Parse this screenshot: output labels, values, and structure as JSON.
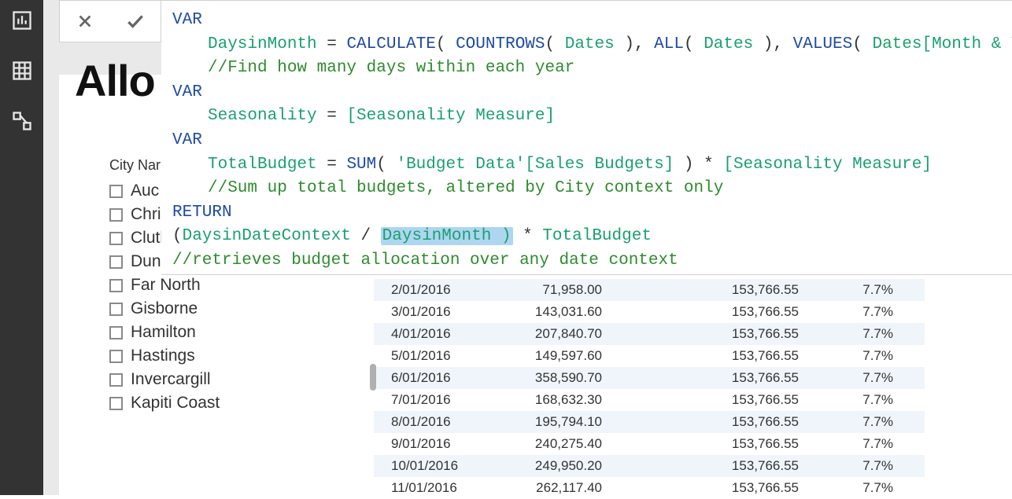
{
  "page_title": "Allo",
  "slicer": {
    "label": "City Nar",
    "items": [
      "Auc",
      "Christchurch",
      "Clutha",
      "Dunedin",
      "Far North",
      "Gisborne",
      "Hamilton",
      "Hastings",
      "Invercargill",
      "Kapiti Coast"
    ]
  },
  "formula": {
    "kw_var": "VAR",
    "kw_return": "RETURN",
    "kw_and": "&",
    "line1_name": "DaysinMonth",
    "line1_eq": " = ",
    "fn_calculate": "CALCULATE",
    "fn_countrows": "COUNTROWS",
    "fn_all": "ALL",
    "fn_values": "VALUES",
    "tbl_dates": "Dates",
    "col_monthyear": "Dates[Month & Year]",
    "cm1": "//Find how many days within each year",
    "line2_name": "Seasonality",
    "meas_seasonality": "[Seasonality Measure]",
    "line3_name": "TotalBudget",
    "fn_sum": "SUM",
    "ref_salesbudgets": "'Budget Data'[Sales Budgets]",
    "cm2": "//Sum up total budgets, altered by City context only",
    "ret_a": "DaysinDateContext",
    "ret_b": "DaysinMonth )",
    "ret_c": "TotalBudget",
    "cm3": "//retrieves budget allocation over any date context"
  },
  "table": {
    "rows": [
      {
        "date": "2/01/2016",
        "v1": "71,958.00",
        "v2": "153,766.55",
        "v3": "7.7%"
      },
      {
        "date": "3/01/2016",
        "v1": "143,031.60",
        "v2": "153,766.55",
        "v3": "7.7%"
      },
      {
        "date": "4/01/2016",
        "v1": "207,840.70",
        "v2": "153,766.55",
        "v3": "7.7%"
      },
      {
        "date": "5/01/2016",
        "v1": "149,597.60",
        "v2": "153,766.55",
        "v3": "7.7%"
      },
      {
        "date": "6/01/2016",
        "v1": "358,590.70",
        "v2": "153,766.55",
        "v3": "7.7%"
      },
      {
        "date": "7/01/2016",
        "v1": "168,632.30",
        "v2": "153,766.55",
        "v3": "7.7%"
      },
      {
        "date": "8/01/2016",
        "v1": "195,794.10",
        "v2": "153,766.55",
        "v3": "7.7%"
      },
      {
        "date": "9/01/2016",
        "v1": "240,275.40",
        "v2": "153,766.55",
        "v3": "7.7%"
      },
      {
        "date": "10/01/2016",
        "v1": "249,950.20",
        "v2": "153,766.55",
        "v3": "7.7%"
      },
      {
        "date": "11/01/2016",
        "v1": "262,117.40",
        "v2": "153,766.55",
        "v3": "7.7%"
      }
    ]
  }
}
